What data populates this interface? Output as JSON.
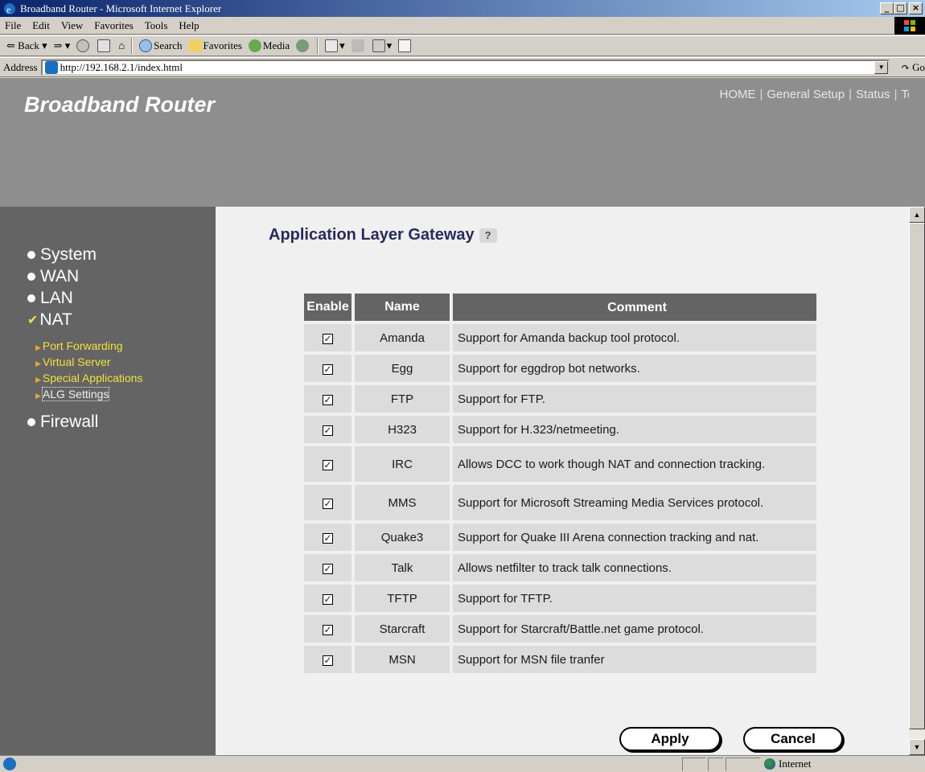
{
  "window": {
    "title": "Broadband Router - Microsoft Internet Explorer",
    "min_label": "_",
    "max_label": "□",
    "close_label": "×"
  },
  "menu": [
    "File",
    "Edit",
    "View",
    "Favorites",
    "Tools",
    "Help"
  ],
  "toolbar": {
    "back": "Back",
    "search": "Search",
    "favorites": "Favorites",
    "media": "Media"
  },
  "address": {
    "label": "Address",
    "url": "http://192.168.2.1/index.html",
    "go": "Go"
  },
  "banner": {
    "brand": "Broadband Router",
    "nav": [
      "HOME",
      "General Setup",
      "Status",
      "Tool"
    ]
  },
  "sidebar": {
    "items": [
      {
        "label": "System"
      },
      {
        "label": "WAN"
      },
      {
        "label": "LAN"
      },
      {
        "label": "NAT"
      },
      {
        "label": "Firewall"
      }
    ],
    "subitems": [
      {
        "label": "Port Forwarding"
      },
      {
        "label": "Virtual Server"
      },
      {
        "label": "Special Applications"
      },
      {
        "label": "ALG Settings"
      }
    ]
  },
  "main": {
    "title": "Application Layer Gateway",
    "columns": [
      "Enable",
      "Name",
      "Comment"
    ],
    "rows": [
      {
        "name": "Amanda",
        "comment": "Support for Amanda backup tool protocol.",
        "enabled": true
      },
      {
        "name": "Egg",
        "comment": "Support for eggdrop bot networks.",
        "enabled": true
      },
      {
        "name": "FTP",
        "comment": "Support for FTP.",
        "enabled": true
      },
      {
        "name": "H323",
        "comment": "Support for H.323/netmeeting.",
        "enabled": true
      },
      {
        "name": "IRC",
        "comment": "Allows DCC to work though NAT and connection tracking.",
        "enabled": true
      },
      {
        "name": "MMS",
        "comment": "Support for Microsoft Streaming Media Services protocol.",
        "enabled": true
      },
      {
        "name": "Quake3",
        "comment": "Support for Quake III Arena connection tracking and nat.",
        "enabled": true
      },
      {
        "name": "Talk",
        "comment": "Allows netfilter to track talk connections.",
        "enabled": true
      },
      {
        "name": "TFTP",
        "comment": "Support for TFTP.",
        "enabled": true
      },
      {
        "name": "Starcraft",
        "comment": "Support for Starcraft/Battle.net game protocol.",
        "enabled": true
      },
      {
        "name": "MSN",
        "comment": "Support for MSN file tranfer",
        "enabled": true
      }
    ],
    "apply_label": "Apply",
    "cancel_label": "Cancel"
  },
  "status": {
    "zone": "Internet"
  },
  "colors": {
    "banner": "#8e8e8e",
    "sidebar": "#646464",
    "submenu_text": "#f0e23a",
    "title_text": "#2a2a5e",
    "header_cell": "#646464",
    "body_cell": "#dcdcdc"
  }
}
